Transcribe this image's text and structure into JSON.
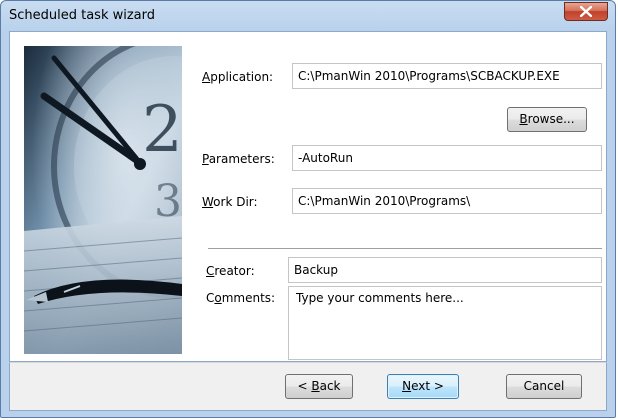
{
  "window": {
    "title": "Scheduled task wizard"
  },
  "form": {
    "application": {
      "label_mnemonic": "A",
      "label_rest": "pplication:",
      "value": "C:\\PmanWin 2010\\Programs\\SCBACKUP.EXE"
    },
    "browse": {
      "mnemonic": "B",
      "rest": "rowse..."
    },
    "parameters": {
      "label_mnemonic": "P",
      "label_rest": "arameters:",
      "value": "-AutoRun"
    },
    "work_dir": {
      "label_mnemonic": "W",
      "label_rest": "ork Dir:",
      "value": "C:\\PmanWin 2010\\Programs\\"
    },
    "creator": {
      "label_mnemonic": "C",
      "label_rest": "reator:",
      "value": "Backup"
    },
    "comments": {
      "label_pre": "C",
      "label_mnemonic": "o",
      "label_rest": "mments:",
      "placeholder": "Type your comments here..."
    }
  },
  "buttons": {
    "back": {
      "prefix": "< ",
      "mnemonic": "B",
      "rest": "ack"
    },
    "next": {
      "mnemonic": "N",
      "rest": "ext >"
    },
    "cancel": {
      "label": "Cancel"
    }
  },
  "colors": {
    "title_gradient_top": "#c9dcf1",
    "close_button": "#c0412b",
    "default_button_border": "#3c7fb1"
  }
}
